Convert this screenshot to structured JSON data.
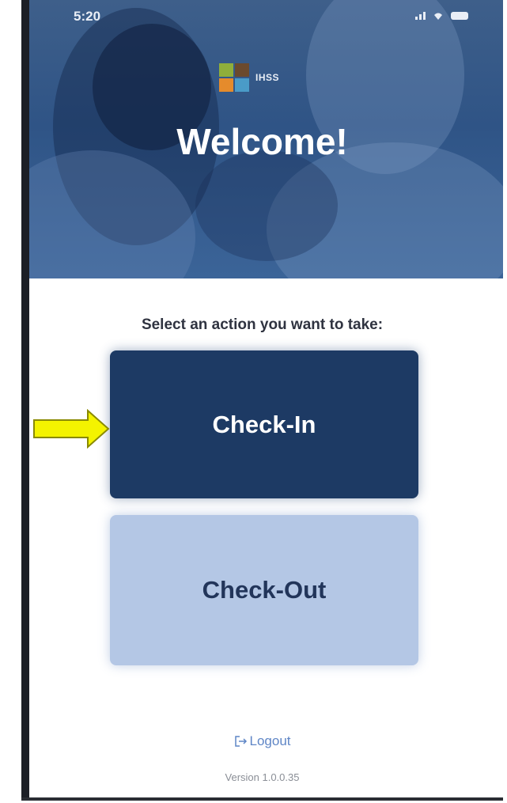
{
  "status_bar": {
    "time": "5:20"
  },
  "logo": {
    "text": "IHSS"
  },
  "header": {
    "title": "Welcome!"
  },
  "main": {
    "prompt": "Select an action you want to take:",
    "checkin_label": "Check-In",
    "checkout_label": "Check-Out"
  },
  "footer": {
    "logout_label": "Logout",
    "version": "Version 1.0.0.35"
  },
  "icons": [
    "signal-icon",
    "wifi-icon",
    "battery-icon",
    "logout-icon",
    "arrow-icon"
  ],
  "colors": {
    "primary": "#1d3a64",
    "secondary": "#b4c7e5",
    "link": "#5f86c6",
    "arrow": "#f4f300"
  }
}
